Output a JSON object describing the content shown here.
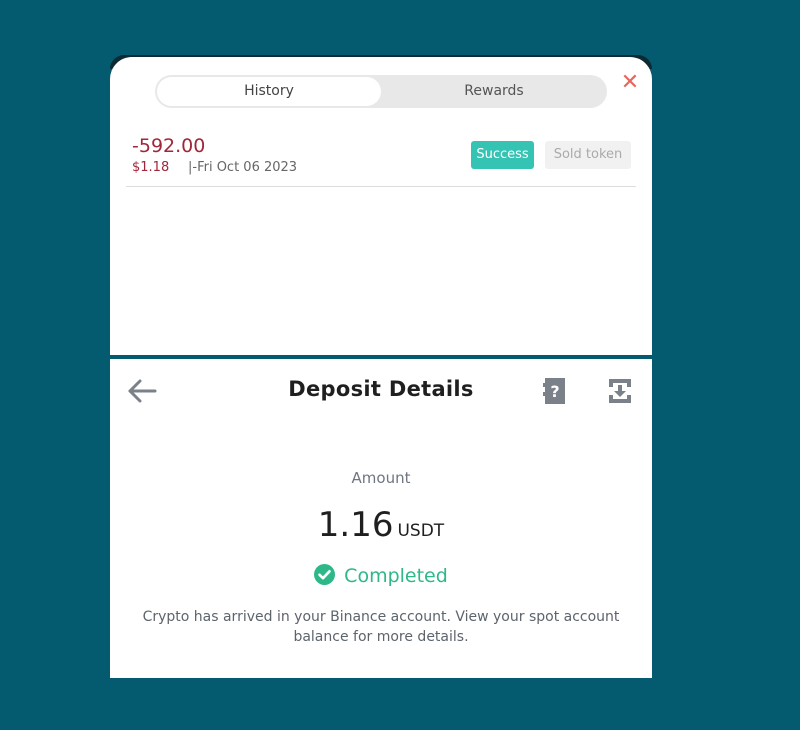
{
  "history_panel": {
    "tabs": [
      {
        "label": "History",
        "active": true
      },
      {
        "label": "Rewards",
        "active": false
      }
    ],
    "close_icon": "close-icon",
    "transaction": {
      "amount": "-592.00",
      "usd_value": "$1.18",
      "date": "|-Fri Oct 06 2023",
      "status_badge": "Success",
      "type_badge": "Sold token"
    }
  },
  "deposit": {
    "title": "Deposit Details",
    "icons": [
      "back-arrow-icon",
      "help-icon",
      "download-icon"
    ],
    "amount_label": "Amount",
    "amount_value": "1.16",
    "amount_unit": "USDT",
    "status": "Completed",
    "description": "Crypto has arrived in your Binance account. View your spot account balance for more details."
  },
  "colors": {
    "background": "#045a6e",
    "negative_amount": "#a0273a",
    "success_badge": "#35c4b4",
    "completed_green": "#2eb88a",
    "close_red": "#e8655c"
  }
}
